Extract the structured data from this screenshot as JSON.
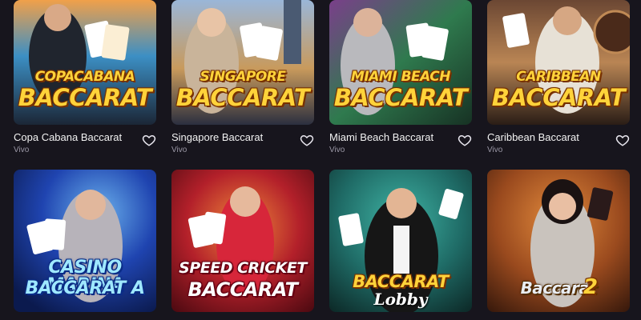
{
  "games": [
    {
      "title": "Copa Cabana Baccarat",
      "provider": "Vivo",
      "art_top": "COPACABANA",
      "art_main": "BACCARAT",
      "palette": [
        "#f4a64a",
        "#2d7fb8",
        "#1c2a3a"
      ]
    },
    {
      "title": "Singapore Baccarat",
      "provider": "Vivo",
      "art_top": "SINGAPORE",
      "art_main": "BACCARAT",
      "palette": [
        "#9fb8d6",
        "#d8a25a",
        "#2b3346"
      ]
    },
    {
      "title": "Miami Beach Baccarat",
      "provider": "Vivo",
      "art_top": "MIAMI BEACH",
      "art_main": "BACCARAT",
      "palette": [
        "#3b8a5a",
        "#a35bb0",
        "#1c2b22"
      ]
    },
    {
      "title": "Caribbean Baccarat",
      "provider": "Vivo",
      "art_top": "CARIBBEAN",
      "art_main": "BACCARAT",
      "palette": [
        "#5a3a2a",
        "#c08a55",
        "#2a1d16"
      ]
    },
    {
      "art_top": "CASINO MARINA",
      "art_main": "BACCARAT A",
      "palette": [
        "#1e3fa8",
        "#5a9bdc",
        "#0d1c4a"
      ]
    },
    {
      "art_top": "SPEED CRICKET",
      "art_main": "BACCARAT",
      "palette": [
        "#b3202a",
        "#e35a2a",
        "#4a0a12"
      ]
    },
    {
      "art_top": "BACCARAT",
      "art_main": "Lobby",
      "palette": [
        "#1f6b66",
        "#2f9a8e",
        "#0f2f2d"
      ]
    },
    {
      "art_top": "Baccarat",
      "art_main": "2",
      "palette": [
        "#9a4a1e",
        "#d0702a",
        "#3a1a0c"
      ]
    }
  ],
  "icons": {
    "favorite": "heart-outline-icon"
  }
}
